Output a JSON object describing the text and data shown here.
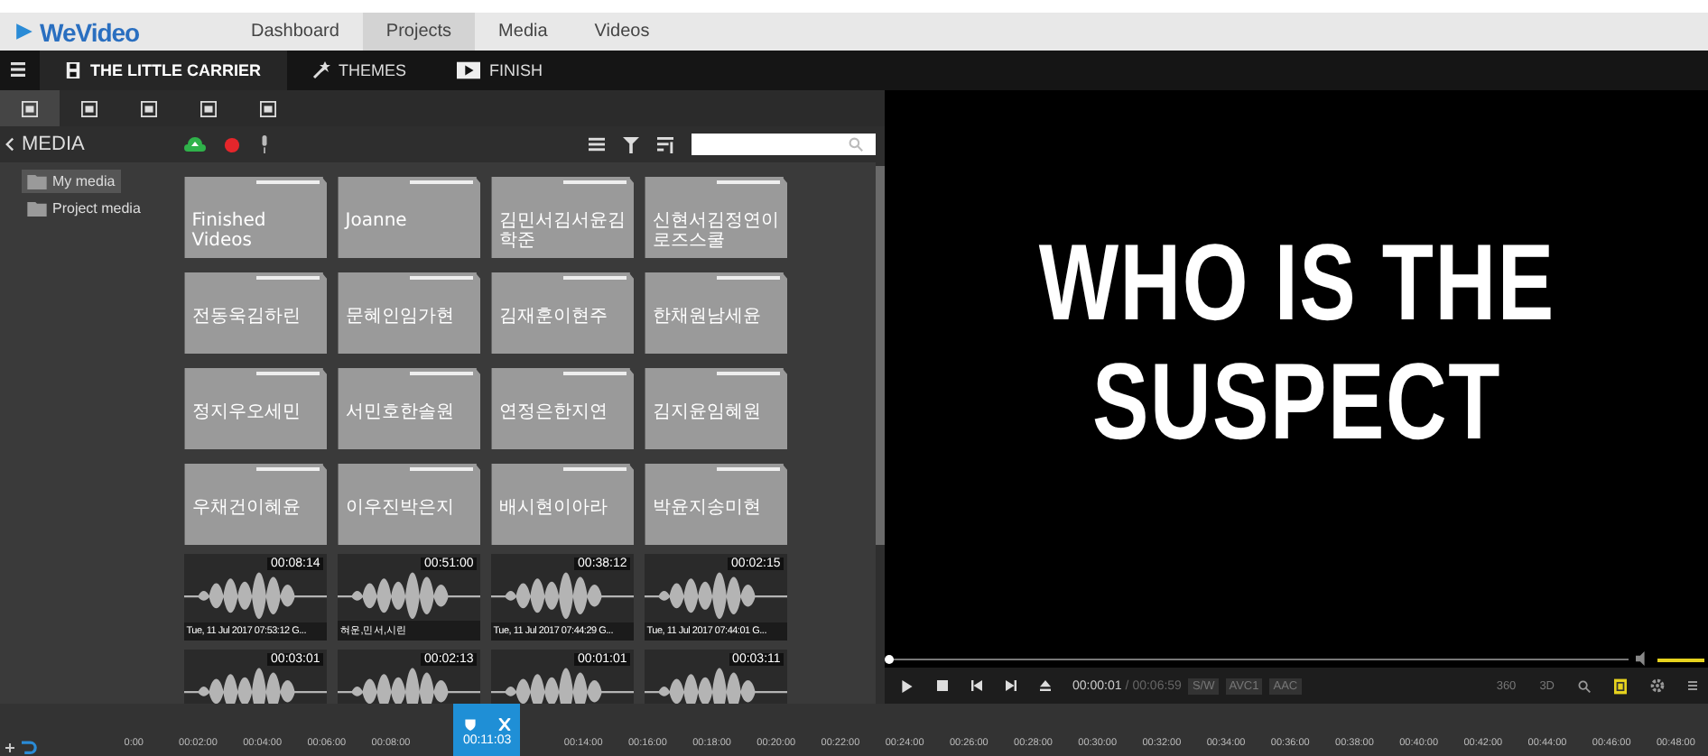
{
  "nav": {
    "logo": "WeVideo",
    "tabs": [
      {
        "label": "Dashboard",
        "selected": false
      },
      {
        "label": "Projects",
        "selected": true
      },
      {
        "label": "Media",
        "selected": false
      },
      {
        "label": "Videos",
        "selected": false
      }
    ]
  },
  "project_bar": {
    "tabs": [
      {
        "label": "THE LITTLE CARRIER",
        "kind": "project",
        "selected": true
      },
      {
        "label": "THEMES",
        "kind": "themes",
        "selected": false
      },
      {
        "label": "FINISH",
        "kind": "finish",
        "selected": false
      }
    ]
  },
  "panel_tabs": [
    {
      "selected": true
    },
    {
      "selected": false
    },
    {
      "selected": false
    },
    {
      "selected": false
    },
    {
      "selected": false
    }
  ],
  "media_toolbar": {
    "title": "MEDIA"
  },
  "sidebar": {
    "items": [
      {
        "label": "My media",
        "selected": true
      },
      {
        "label": "Project media",
        "selected": false
      }
    ]
  },
  "folders": [
    {
      "label": "Finished Videos"
    },
    {
      "label": "Joanne"
    },
    {
      "label": "김민서김서윤김학준"
    },
    {
      "label": "신현서김정연이로즈스쿨"
    },
    {
      "label": "전동욱김하린"
    },
    {
      "label": "문혜인임가현"
    },
    {
      "label": "김재훈이현주"
    },
    {
      "label": "한채원남세윤"
    },
    {
      "label": "정지우오세민"
    },
    {
      "label": "서민호한솔원"
    },
    {
      "label": "연정은한지연"
    },
    {
      "label": "김지윤임혜원"
    },
    {
      "label": "우채건이혜윤"
    },
    {
      "label": "이우진박은지"
    },
    {
      "label": "배시현이아라"
    },
    {
      "label": "박윤지송미현"
    }
  ],
  "audio_clips": [
    {
      "duration": "00:08:14",
      "caption": "Tue, 11 Jul 2017 07:53:12 G..."
    },
    {
      "duration": "00:51:00",
      "caption": "혀운,민서,시린"
    },
    {
      "duration": "00:38:12",
      "caption": "Tue, 11 Jul 2017 07:44:29 G..."
    },
    {
      "duration": "00:02:15",
      "caption": "Tue, 11 Jul 2017 07:44:01 G..."
    },
    {
      "duration": "00:03:01"
    },
    {
      "duration": "00:02:13"
    },
    {
      "duration": "00:01:01"
    },
    {
      "duration": "00:03:11"
    }
  ],
  "preview": {
    "lines": [
      "WHO IS THE",
      "SUSPECT"
    ]
  },
  "player": {
    "position": {
      "level": 0.0
    },
    "volume": {
      "level": 1.0
    },
    "current_time": "00:00:01",
    "separator": "/",
    "total_time": "00:06:59",
    "badges": [
      "S/W",
      "AVC1",
      "AAC"
    ],
    "right_labels": [
      "360",
      "3D"
    ]
  },
  "timeline": {
    "ticks_before": [
      "0:00",
      "00:02:00",
      "00:04:00",
      "00:06:00",
      "00:08:00"
    ],
    "playhead": "00:11:03",
    "ticks_after": [
      "00:14:00",
      "00:16:00",
      "00:18:00",
      "00:20:00",
      "00:22:00",
      "00:24:00",
      "00:26:00",
      "00:28:00",
      "00:30:00",
      "00:32:00",
      "00:34:00",
      "00:36:00",
      "00:38:00",
      "00:40:00",
      "00:42:00",
      "00:44:00",
      "00:46:00",
      "00:48:00"
    ]
  }
}
